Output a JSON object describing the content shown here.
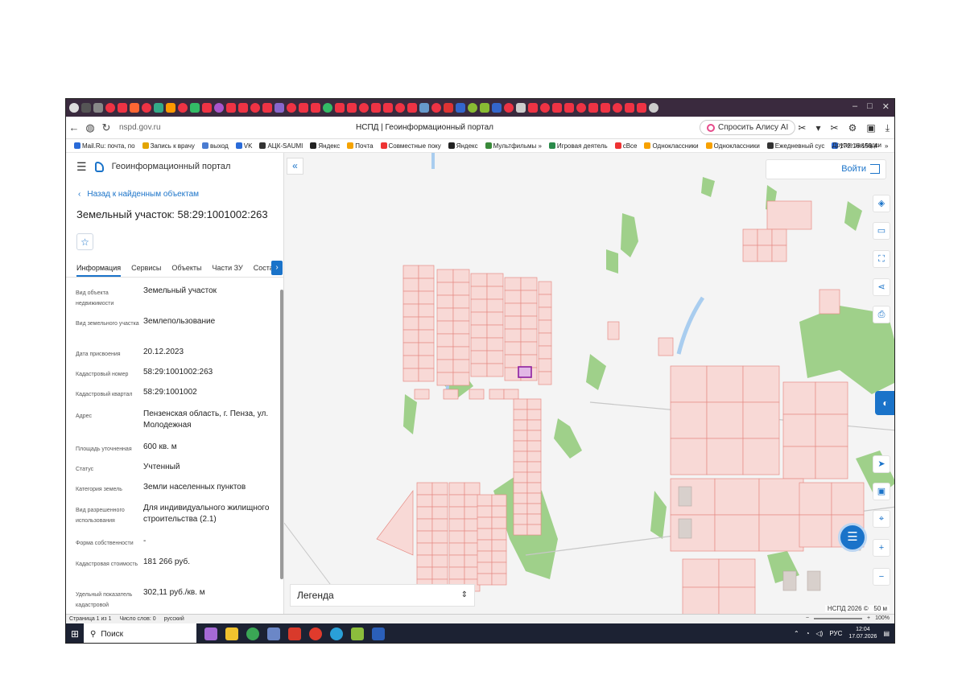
{
  "browser": {
    "url": "nspd.gov.ru",
    "page_title": "НСПД | Геоинформационный портал",
    "alice_label": "Спросить Алису AI",
    "bookmarks": [
      "Mail.Ru: почта, по",
      "Запись к врачу",
      "выход",
      "VK",
      "АЦК-SAUMI",
      "Яндекс",
      "Почта",
      "Совместные поку",
      "Яндекс",
      "Мультфильмы »",
      "Игровая деятель",
      "сВсе",
      "Одноклассники",
      "Одноклассники",
      "Ежедневный сус",
      "172.16.159.4"
    ],
    "other_bookmarks": "Другие закладки",
    "more": "»"
  },
  "portal": {
    "name": "Геоинформационный портал",
    "back_label": "Назад к найденным объектам",
    "object_title": "Земельный участок: 58:29:1001002:263",
    "tabs": [
      "Информация",
      "Сервисы",
      "Объекты",
      "Части ЗУ",
      "Состав"
    ],
    "properties": [
      {
        "label": "Вид объекта недвижимости",
        "value": "Земельный участок"
      },
      {
        "label": "Вид земельного участка",
        "value": "Землепользование"
      },
      {
        "label": "Дата присвоения",
        "value": "20.12.2023"
      },
      {
        "label": "Кадастровый номер",
        "value": "58:29:1001002:263"
      },
      {
        "label": "Кадастровый квартал",
        "value": "58:29:1001002"
      },
      {
        "label": "Адрес",
        "value": "Пензенская область, г. Пенза, ул. Молодежная"
      },
      {
        "label": "Площадь уточненная",
        "value": "600 кв. м"
      },
      {
        "label": "Статус",
        "value": "Учтенный"
      },
      {
        "label": "Категория земель",
        "value": "Земли населенных пунктов"
      },
      {
        "label": "Вид разрешенного использования",
        "value": "Для индивидуального жилищного строительства (2.1)"
      },
      {
        "label": "Форма собственности",
        "value": "-"
      },
      {
        "label": "Кадастровая стоимость",
        "value": "181 266 руб."
      },
      {
        "label": "Удельный показатель кадастровой",
        "value": "302,11 руб./кв. м"
      }
    ]
  },
  "map": {
    "login_label": "Войти",
    "legend_label": "Легенда",
    "attribution": "НСПД 2026 ©",
    "scale": "50 м",
    "colors": {
      "parcel_fill": "#f8d9d6",
      "parcel_stroke": "#e58c85",
      "green": "#9fd08a",
      "water": "#a9cdef",
      "selected": "#8e1fa0",
      "accent": "#1a73c9"
    }
  },
  "statusbar": {
    "page": "Страница 1 из 1",
    "words": "Число слов: 0",
    "lang": "русский",
    "zoom": "100%"
  },
  "taskbar": {
    "search_label": "Поиск",
    "lang": "РУС",
    "time": "12:04",
    "date": "17.07.2026"
  }
}
